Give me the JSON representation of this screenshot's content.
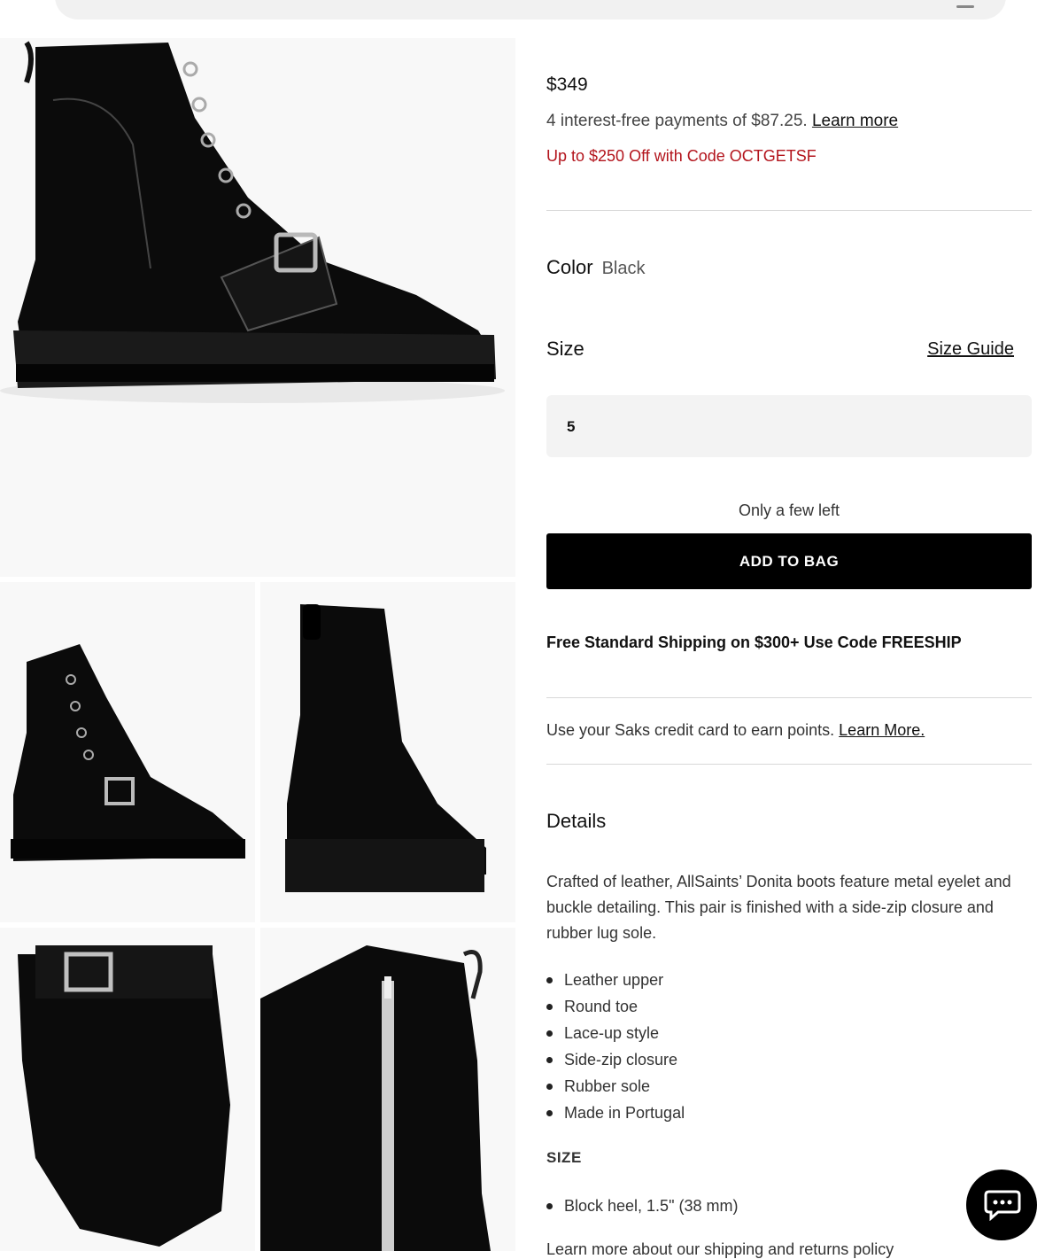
{
  "product": {
    "price": "$349",
    "installments_text": "4 interest-free payments of $87.25.",
    "installments_link": "Learn more",
    "promo": "Up to $250 Off with Code OCTGETSF"
  },
  "color": {
    "label": "Color",
    "value": "Black"
  },
  "size": {
    "label": "Size",
    "guide_link": "Size Guide",
    "selected": "5"
  },
  "stock_status": "Only a few left",
  "add_to_bag": "ADD TO BAG",
  "shipping_promo": "Free Standard Shipping on $300+ Use Code FREESHIP",
  "credit": {
    "text": "Use your Saks credit card to earn points.",
    "link": "Learn More."
  },
  "details": {
    "title": "Details",
    "description": "Crafted of leather, AllSaints’ Donita boots feature metal eyelet and buckle detailing. This pair is finished with a side-zip closure and rubber lug sole.",
    "features": [
      "Leather upper",
      "Round toe",
      "Lace-up style",
      "Side-zip closure",
      "Rubber sole",
      "Made in Portugal"
    ],
    "size_heading": "SIZE",
    "size_features": [
      "Block heel, 1.5\" (38 mm)"
    ],
    "footer_text": "Learn more about our shipping and returns policy"
  },
  "icons": {
    "chat": "chat-bubble-icon"
  },
  "colors": {
    "promo_red": "#b3141c",
    "button_bg": "#000000"
  }
}
